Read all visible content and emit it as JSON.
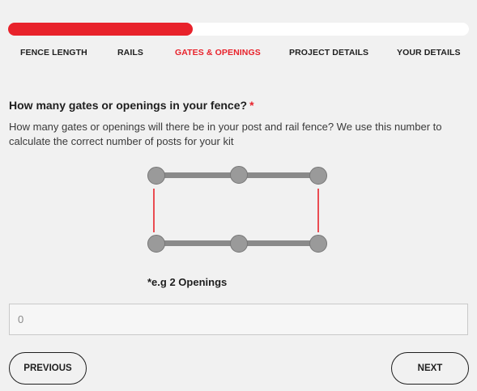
{
  "progress": {
    "value_percent": 40,
    "fill_color": "#e8222b",
    "track_color": "#ffffff"
  },
  "steps": [
    {
      "label": "FENCE LENGTH",
      "active": false
    },
    {
      "label": "RAILS",
      "active": false
    },
    {
      "label": "GATES & OPENINGS",
      "active": true
    },
    {
      "label": "PROJECT DETAILS",
      "active": false
    },
    {
      "label": "YOUR DETAILS",
      "active": false
    }
  ],
  "question": {
    "title": "How many gates or openings in your fence?",
    "required_mark": "*",
    "help_text": "How many gates or openings will there be in your post and rail fence? We use this number to calculate the correct number of posts for your kit"
  },
  "example": {
    "caption": "*e.g 2 Openings",
    "opening_color": "#e8222b",
    "rail_color": "#8a8a8a",
    "post_color": "#9a9a9a"
  },
  "input": {
    "value": "",
    "placeholder": "0"
  },
  "buttons": {
    "previous": "PREVIOUS",
    "next": "NEXT"
  }
}
